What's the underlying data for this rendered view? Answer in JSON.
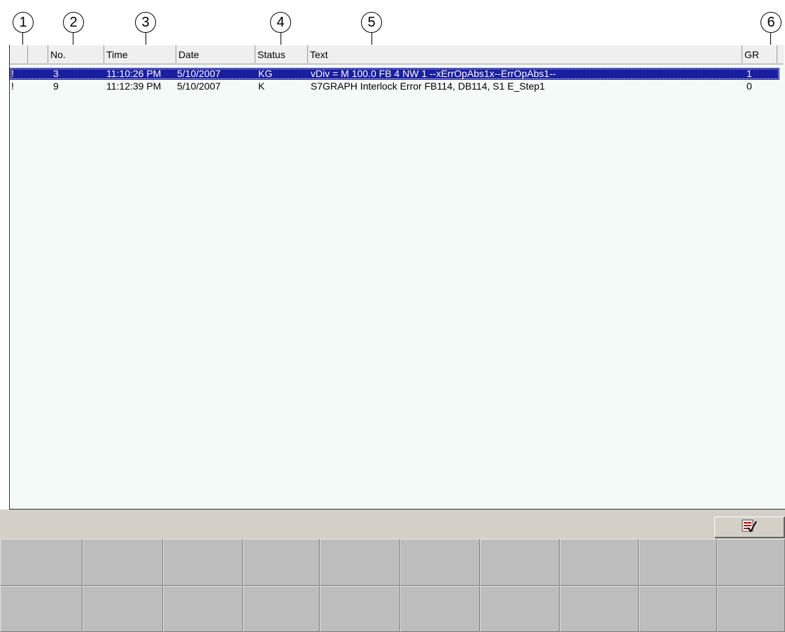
{
  "callouts": [
    "1",
    "2",
    "3",
    "4",
    "5",
    "6"
  ],
  "table": {
    "columns": [
      "",
      "",
      "No.",
      "Time",
      "Date",
      "Status",
      "Text",
      "GR"
    ],
    "rows": [
      {
        "marker": "!",
        "no": "3",
        "time": "11:10:26 PM",
        "date": "5/10/2007",
        "status": "KG",
        "text": "vDiv = M 100.0  FB 4    NW 1 --xErrOpAbs1x--ErrOpAbs1--",
        "gr": "1",
        "selected": true
      },
      {
        "marker": "!",
        "no": "9",
        "time": "11:12:39 PM",
        "date": "5/10/2007",
        "status": "K",
        "text": "S7GRAPH Interlock Error   FB114, DB114, S1  E_Step1",
        "gr": "0",
        "selected": false
      }
    ]
  },
  "toolbar": {
    "acknowledge_icon": "acknowledge-list-icon"
  },
  "softkeys": {
    "top_row_count": 10,
    "bottom_row_count": 10
  },
  "colors": {
    "selection": "#1a1fa0",
    "panel_background": "#f4faf8",
    "softkey": "#bdbdbd",
    "strip": "#d4d0c8"
  }
}
